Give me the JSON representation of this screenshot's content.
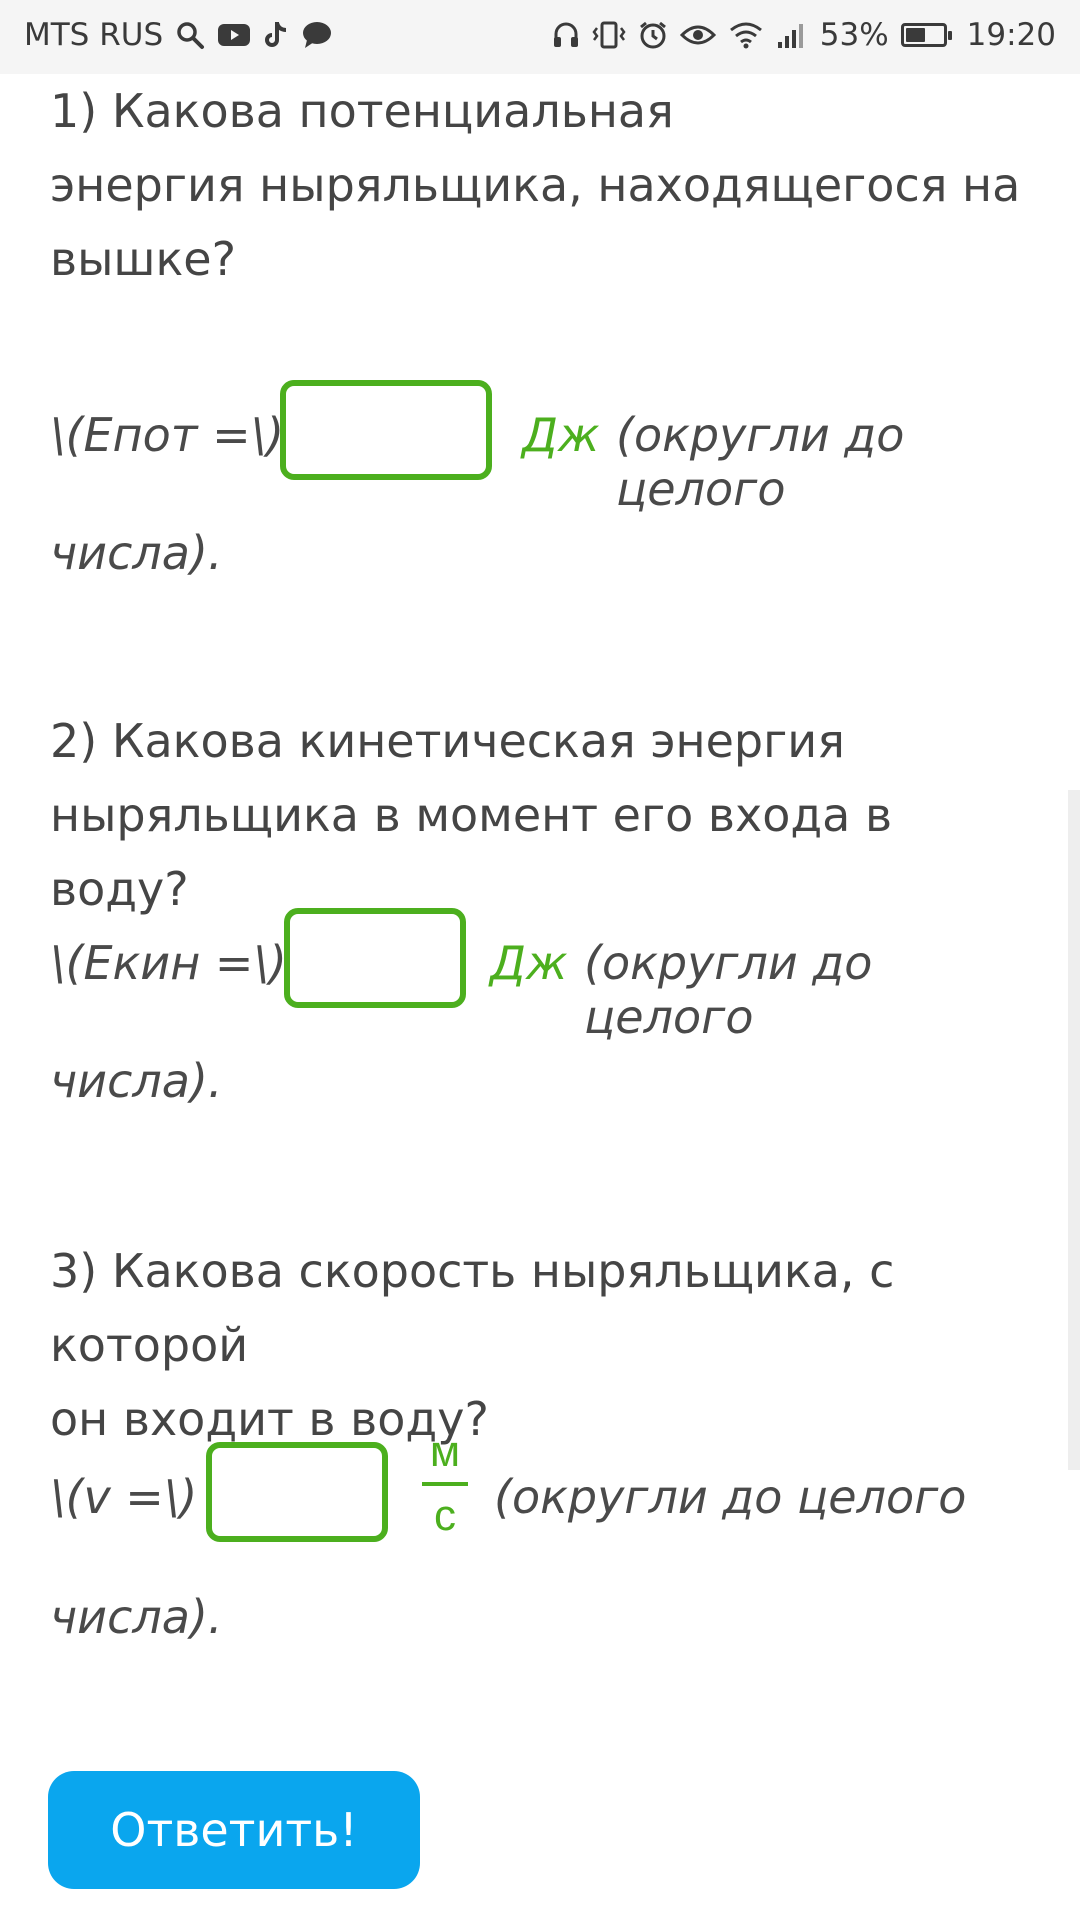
{
  "status_bar": {
    "carrier": "MTS RUS",
    "battery_percent_text": "53%",
    "battery_level": 0.53,
    "time": "19:20",
    "left_icons": [
      "search-icon",
      "youtube-icon",
      "tiktok-icon",
      "chat-bubble-icon"
    ],
    "right_icons": [
      "headphones-icon",
      "vibrate-icon",
      "alarm-icon",
      "eye-icon",
      "wifi-icon",
      "signal-icon"
    ]
  },
  "questions": [
    {
      "text_line1": "1) Какова потенциальная",
      "text_line2": "энергия ныряльщика, находящегося на",
      "text_line3": "вышке?",
      "prefix": "\\(Eпот =\\)",
      "input_value": "",
      "unit": "Дж",
      "hint": "(округли до целого",
      "hint_cont": "числа)."
    },
    {
      "text_line1": "2) Какова кинетическая энергия",
      "text_line2": "ныряльщика в момент его входа в воду?",
      "prefix": "\\(Eкин =\\)",
      "input_value": "",
      "unit": "Дж",
      "hint": "(округли до целого",
      "hint_cont": "числа)."
    },
    {
      "text_line1": "3) Какова скорость ныряльщика, с которой",
      "text_line2": "он входит в воду?",
      "prefix": "\\(v =\\)",
      "input_value": "",
      "unit_numerator": "м",
      "unit_denominator": "с",
      "hint": "(округли до целого",
      "hint_cont": "числа)."
    }
  ],
  "submit_label": "Ответить!",
  "colors": {
    "accent_green": "#4caf1e",
    "button_blue": "#0aa6ee",
    "text_gray": "#454545"
  }
}
